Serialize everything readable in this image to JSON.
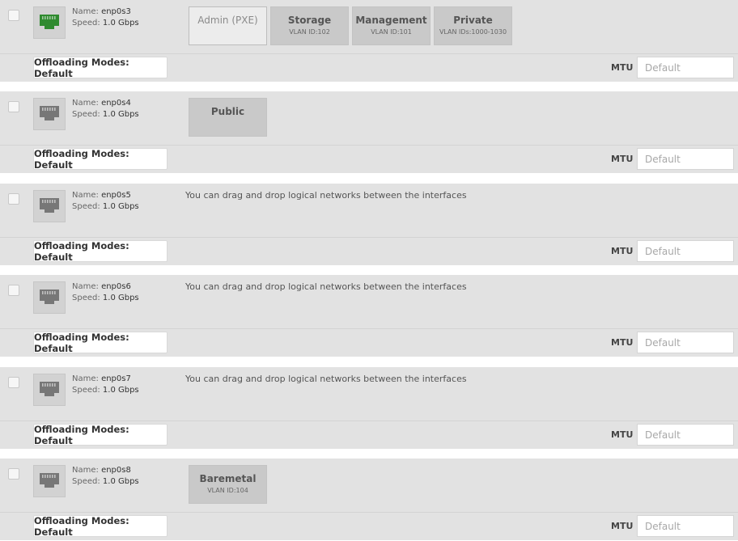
{
  "interfaces": [
    {
      "name_label": "Name:",
      "name": "enp0s3",
      "speed_label": "Speed:",
      "speed": "1.0 Gbps",
      "port_color": "#2f8a2f",
      "networks": [
        {
          "name": "Admin (PXE)",
          "vlan": "",
          "kind": "admin"
        },
        {
          "name": "Storage",
          "vlan": "VLAN ID:102"
        },
        {
          "name": "Management",
          "vlan": "VLAN ID:101"
        },
        {
          "name": "Private",
          "vlan": "VLAN IDs:1000-1030"
        }
      ],
      "hint": "",
      "offloading": "Offloading Modes: Default",
      "mtu_label": "MTU",
      "mtu_placeholder": "Default",
      "mtu_value": ""
    },
    {
      "name_label": "Name:",
      "name": "enp0s4",
      "speed_label": "Speed:",
      "speed": "1.0 Gbps",
      "port_color": "#777777",
      "networks": [
        {
          "name": "Public",
          "vlan": ""
        }
      ],
      "hint": "",
      "offloading": "Offloading Modes: Default",
      "mtu_label": "MTU",
      "mtu_placeholder": "Default",
      "mtu_value": ""
    },
    {
      "name_label": "Name:",
      "name": "enp0s5",
      "speed_label": "Speed:",
      "speed": "1.0 Gbps",
      "port_color": "#777777",
      "networks": [],
      "hint": "You can drag and drop logical networks between the interfaces",
      "offloading": "Offloading Modes: Default",
      "mtu_label": "MTU",
      "mtu_placeholder": "Default",
      "mtu_value": ""
    },
    {
      "name_label": "Name:",
      "name": "enp0s6",
      "speed_label": "Speed:",
      "speed": "1.0 Gbps",
      "port_color": "#777777",
      "networks": [],
      "hint": "You can drag and drop logical networks between the interfaces",
      "offloading": "Offloading Modes: Default",
      "mtu_label": "MTU",
      "mtu_placeholder": "Default",
      "mtu_value": ""
    },
    {
      "name_label": "Name:",
      "name": "enp0s7",
      "speed_label": "Speed:",
      "speed": "1.0 Gbps",
      "port_color": "#777777",
      "networks": [],
      "hint": "You can drag and drop logical networks between the interfaces",
      "offloading": "Offloading Modes: Default",
      "mtu_label": "MTU",
      "mtu_placeholder": "Default",
      "mtu_value": ""
    },
    {
      "name_label": "Name:",
      "name": "enp0s8",
      "speed_label": "Speed:",
      "speed": "1.0 Gbps",
      "port_color": "#777777",
      "networks": [
        {
          "name": "Baremetal",
          "vlan": "VLAN ID:104"
        }
      ],
      "hint": "",
      "offloading": "Offloading Modes: Default",
      "mtu_label": "MTU",
      "mtu_placeholder": "Default",
      "mtu_value": ""
    }
  ]
}
